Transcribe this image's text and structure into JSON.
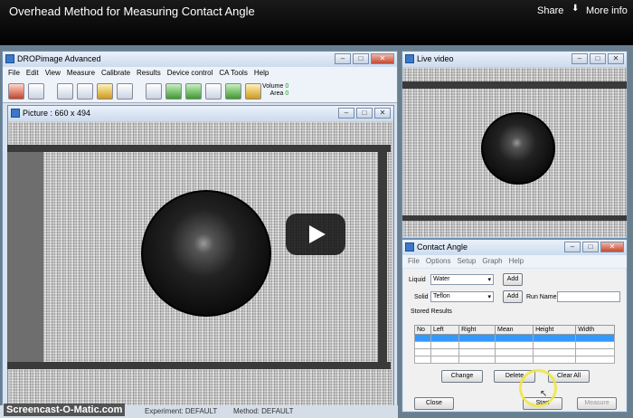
{
  "video": {
    "title": "Overhead Method for Measuring Contact Angle",
    "share_label": "Share",
    "moreinfo_label": "More info",
    "watermark": "Screencast-O-Matic.com"
  },
  "main_window": {
    "title": "DROPimage Advanced",
    "menu": [
      "File",
      "Edit",
      "View",
      "Measure",
      "Calibrate",
      "Results",
      "Device control",
      "CA Tools",
      "Help"
    ],
    "volume_label": "Volume",
    "volume_value": "0",
    "area_label": "Area",
    "area_value": "0"
  },
  "picture_window": {
    "title": "Picture : 660 x 494"
  },
  "live_window": {
    "title": "Live video"
  },
  "contact_angle": {
    "title": "Contact Angle",
    "menu": [
      "File",
      "Options",
      "Setup",
      "Graph",
      "Help"
    ],
    "liquid_label": "Liquid",
    "liquid_value": "Water",
    "solid_label": "Solid",
    "solid_value": "Teflon",
    "add_label": "Add",
    "run_name_label": "Run Name",
    "stored_results_label": "Stored Results",
    "columns": [
      "No",
      "Left",
      "Right",
      "Mean",
      "Height",
      "Width"
    ],
    "change_label": "Change",
    "delete_label": "Delete",
    "clear_all_label": "Clear All",
    "close_label": "Close",
    "start_label": "Start",
    "measure_label": "Measure"
  },
  "status": {
    "experiment": "Experiment: DEFAULT",
    "method": "Method: DEFAULT"
  },
  "colors": {
    "accent": "#3399ff",
    "title_bg": "#d9e4f1"
  }
}
